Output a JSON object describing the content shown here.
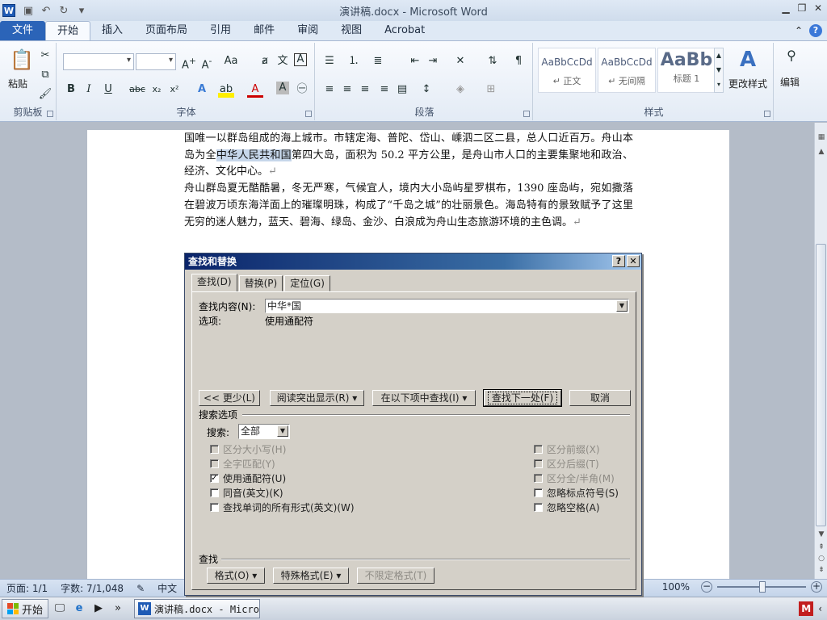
{
  "window": {
    "title": "演讲稿.docx - Microsoft Word",
    "app_icon_letter": "W"
  },
  "ribbon_tabs": [
    {
      "label": "文件",
      "active": false
    },
    {
      "label": "开始",
      "active": true
    },
    {
      "label": "插入",
      "active": false
    },
    {
      "label": "页面布局",
      "active": false
    },
    {
      "label": "引用",
      "active": false
    },
    {
      "label": "邮件",
      "active": false
    },
    {
      "label": "审阅",
      "active": false
    },
    {
      "label": "视图",
      "active": false
    },
    {
      "label": "Acrobat",
      "active": false
    }
  ],
  "ribbon_groups": {
    "clipboard": {
      "label": "剪贴板",
      "paste": "粘贴"
    },
    "font": {
      "label": "字体"
    },
    "paragraph": {
      "label": "段落"
    },
    "styles": {
      "label": "样式",
      "items": [
        {
          "sample": "AaBbCcDd",
          "name": "↵ 正文"
        },
        {
          "sample": "AaBbCcDd",
          "name": "↵ 无间隔"
        },
        {
          "sample": "AaBb",
          "name": "标题 1"
        }
      ],
      "change_styles": "更改样式"
    },
    "editing": {
      "label": "编辑"
    }
  },
  "document": {
    "para1_before": "国唯一以群岛组成的海上城市。市辖定海、普陀、岱山、嵊泗二区二县，总人口近百万。舟山本岛为全",
    "para1_highlight": "中华人民共和国",
    "para1_after": "第四大岛，面积为 50.2 平方公里，是舟山市人口的主要集聚地和政治、经济、文化中心。",
    "para2": "舟山群岛夏无酷酷暑，冬无严寒，气候宜人，境内大小岛屿星罗棋布，1390 座岛屿，宛如撒落在碧波万顷东海洋面上的璀璨明珠，构成了“千岛之城”的壮丽景色。海岛特有的景致赋予了这里无穷的迷人魅力，蓝天、碧海、绿岛、金沙、白浪成为舟山生态旅游环境的主色调。",
    "para_mark": "↵"
  },
  "dialog": {
    "title": "查找和替换",
    "help_btn": "?",
    "close_btn": "✕",
    "tabs": [
      "查找(D)",
      "替换(P)",
      "定位(G)"
    ],
    "find_label": "查找内容(N):",
    "find_value": "中华*国",
    "options_label": "选项:",
    "options_value": "使用通配符",
    "buttons": {
      "less": "<< 更少(L)",
      "reading_highlight": "阅读突出显示(R) ▾",
      "find_in": "在以下项中查找(I) ▾",
      "find_next": "查找下一处(F)",
      "cancel": "取消"
    },
    "search_options_title": "搜索选项",
    "search_label": "搜索:",
    "search_value": "全部",
    "checkboxes_left": [
      {
        "label": "区分大小写(H)",
        "checked": false,
        "disabled": true
      },
      {
        "label": "全字匹配(Y)",
        "checked": false,
        "disabled": true
      },
      {
        "label": "使用通配符(U)",
        "checked": true,
        "disabled": false
      },
      {
        "label": "同音(英文)(K)",
        "checked": false,
        "disabled": false
      },
      {
        "label": "查找单词的所有形式(英文)(W)",
        "checked": false,
        "disabled": false
      }
    ],
    "checkboxes_right": [
      {
        "label": "区分前缀(X)",
        "checked": false,
        "disabled": true
      },
      {
        "label": "区分后缀(T)",
        "checked": false,
        "disabled": true
      },
      {
        "label": "区分全/半角(M)",
        "checked": false,
        "disabled": true
      },
      {
        "label": "忽略标点符号(S)",
        "checked": false,
        "disabled": false
      },
      {
        "label": "忽略空格(A)",
        "checked": false,
        "disabled": false
      }
    ],
    "find_section_title": "查找",
    "bottom_buttons": {
      "format": "格式(O) ▾",
      "special": "特殊格式(E) ▾",
      "no_format": "不限定格式(T)"
    }
  },
  "statusbar": {
    "page": "页面: 1/1",
    "words": "字数: 7/1,048",
    "lang": "中文",
    "zoom": "100%"
  },
  "taskbar": {
    "start": "开始",
    "task_label": "演讲稿.docx - Micro...",
    "more": "»"
  }
}
